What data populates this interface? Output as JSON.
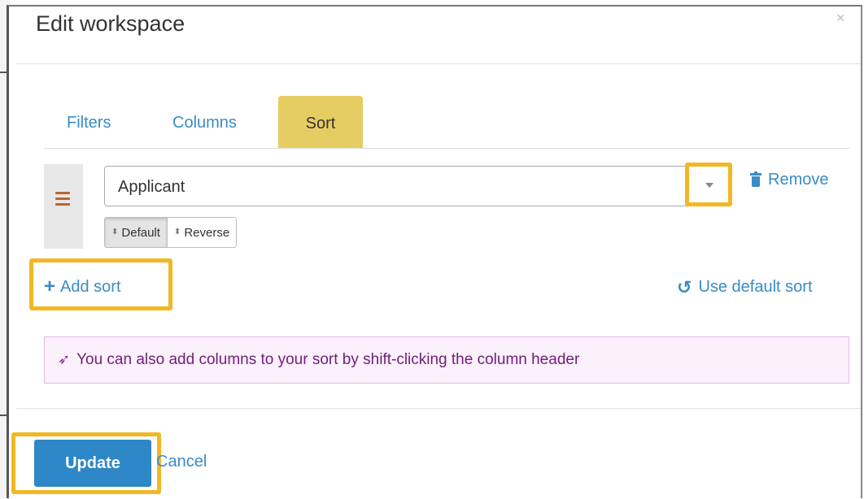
{
  "modal": {
    "title": "Edit workspace",
    "close_icon": "×"
  },
  "tabs": [
    {
      "label": "Filters"
    },
    {
      "label": "Columns"
    },
    {
      "label": "Sort",
      "active": true
    }
  ],
  "sort_rule": {
    "field_value": "Applicant",
    "remove_label": "Remove",
    "direction_options": [
      {
        "label": "Default",
        "selected": true
      },
      {
        "label": "Reverse",
        "selected": false
      }
    ]
  },
  "actions": {
    "add_sort_label": "Add sort",
    "use_default_sort_label": "Use default sort"
  },
  "hint": {
    "text": "You can also add columns to your sort by shift-clicking the column header",
    "icon": "rocket-icon"
  },
  "footer": {
    "update_label": "Update",
    "cancel_label": "Cancel"
  },
  "colors": {
    "link": "#3a8cc7",
    "active_tab": "#e6cd63",
    "highlight": "#f2b823",
    "primary_button": "#2e87c6",
    "hint_bg": "#fbf0fb",
    "hint_text": "#6f1f7a"
  }
}
